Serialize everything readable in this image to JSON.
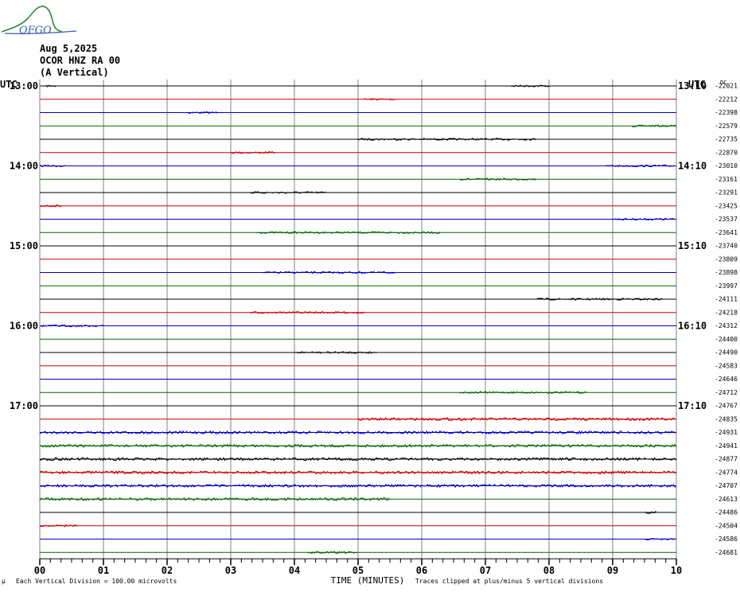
{
  "header": {
    "logo_text": "OFGO",
    "date": "Aug 5,2025",
    "station": "OCOR HNZ RA 00",
    "component": "(A Vertical)"
  },
  "footer": {
    "scale_note": "Each Vertical Division =  100.00 microvolts",
    "clip_note": "Traces clipped at plus/minus 5 vertical divisions",
    "corner_mark": "µ"
  },
  "colors": {
    "trace_cycle": [
      "#000000",
      "#cc0000",
      "#0000cc",
      "#006600"
    ],
    "grid_vertical": "#808080"
  },
  "chart_data": {
    "type": "line",
    "title": "",
    "xlabel": "TIME (MINUTES)",
    "ylabel": "",
    "xlim": [
      0,
      10
    ],
    "x_ticks": [
      "00",
      "01",
      "02",
      "03",
      "04",
      "05",
      "06",
      "07",
      "08",
      "09",
      "10"
    ],
    "left_axis_title": "UTC",
    "right_axis_title": "UTC",
    "left_hour_labels": [
      "13:00",
      "14:00",
      "15:00",
      "16:00",
      "17:00"
    ],
    "right_hour_labels": [
      "13:10",
      "14:10",
      "15:10",
      "16:10",
      "17:10"
    ],
    "right_top_label": "DC",
    "trace_count": 36,
    "first_trace_minute_of_day": 720,
    "minutes_per_trace": 10,
    "dc_offsets": [
      -22021,
      -22212,
      -22398,
      -22579,
      -22735,
      -22870,
      -23010,
      -23161,
      -23291,
      -23425,
      -23537,
      -23641,
      -23740,
      -23809,
      -23898,
      -23997,
      -24111,
      -24218,
      -24312,
      -24400,
      -24490,
      -24583,
      -24646,
      -24712,
      -24767,
      -24835,
      -24931,
      -24941,
      -24877,
      -24774,
      -24707,
      -24613,
      -24486,
      -24504,
      -24586,
      -24681
    ],
    "activity_segments": [
      [
        [
          0.1,
          0.25
        ],
        [
          7.4,
          8.0
        ]
      ],
      [
        [
          5.1,
          5.6
        ]
      ],
      [
        [
          2.3,
          2.8
        ]
      ],
      [
        [
          9.3,
          10.0
        ]
      ],
      [
        [
          5.0,
          7.8
        ]
      ],
      [
        [
          3.0,
          3.7
        ]
      ],
      [
        [
          0.0,
          0.4
        ],
        [
          8.9,
          10.0
        ]
      ],
      [
        [
          6.6,
          7.8
        ]
      ],
      [
        [
          3.3,
          4.5
        ]
      ],
      [
        [
          0.0,
          0.35
        ]
      ],
      [
        [
          9.0,
          10.0
        ]
      ],
      [
        [
          3.4,
          6.3
        ]
      ],
      [],
      [],
      [
        [
          3.5,
          5.6
        ]
      ],
      [],
      [
        [
          7.8,
          9.8
        ]
      ],
      [
        [
          3.3,
          5.1
        ]
      ],
      [
        [
          0.0,
          1.0
        ]
      ],
      [],
      [
        [
          4.0,
          5.3
        ]
      ],
      [],
      [],
      [
        [
          6.6,
          8.6
        ]
      ],
      [],
      [
        [
          5.0,
          10.0
        ]
      ],
      [
        [
          0.0,
          10.0
        ]
      ],
      [
        [
          0.0,
          10.0
        ]
      ],
      [
        [
          0.0,
          10.0
        ]
      ],
      [
        [
          0.0,
          10.0
        ]
      ],
      [
        [
          0.0,
          10.0
        ]
      ],
      [
        [
          0.0,
          5.5
        ]
      ],
      [
        [
          9.5,
          9.7
        ]
      ],
      [
        [
          0.0,
          0.6
        ]
      ],
      [
        [
          9.5,
          10.0
        ]
      ],
      [
        [
          4.2,
          5.0
        ]
      ]
    ]
  }
}
